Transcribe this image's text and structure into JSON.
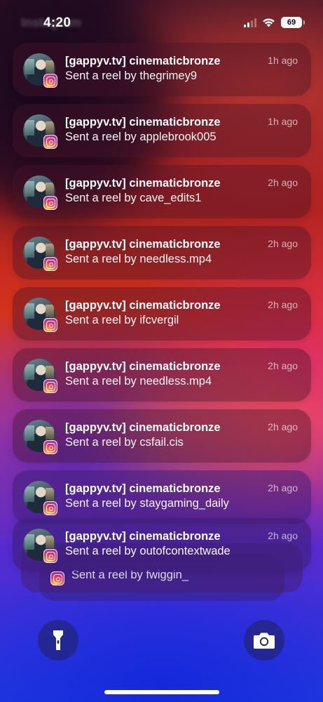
{
  "status_bar": {
    "time": "4:20",
    "faded_title": "Instagram",
    "battery": "69",
    "icons": [
      "signal-icon",
      "wifi-icon",
      "battery-icon"
    ]
  },
  "notifications": [
    {
      "app": "Instagram",
      "title": "[gappyv.tv] cinematicbronze",
      "body": "Sent a reel by thegrimey9",
      "time": "1h ago"
    },
    {
      "app": "Instagram",
      "title": "[gappyv.tv] cinematicbronze",
      "body": "Sent a reel by applebrook005",
      "time": "1h ago"
    },
    {
      "app": "Instagram",
      "title": "[gappyv.tv] cinematicbronze",
      "body": "Sent a reel by cave_edits1",
      "time": "2h ago"
    },
    {
      "app": "Instagram",
      "title": "[gappyv.tv] cinematicbronze",
      "body": "Sent a reel by needless.mp4",
      "time": "2h ago"
    },
    {
      "app": "Instagram",
      "title": "[gappyv.tv] cinematicbronze",
      "body": "Sent a reel by ifcvergil",
      "time": "2h ago"
    },
    {
      "app": "Instagram",
      "title": "[gappyv.tv] cinematicbronze",
      "body": "Sent a reel by needless.mp4",
      "time": "2h ago"
    },
    {
      "app": "Instagram",
      "title": "[gappyv.tv] cinematicbronze",
      "body": "Sent a reel by csfail.cis",
      "time": "2h ago"
    },
    {
      "app": "Instagram",
      "title": "[gappyv.tv] cinematicbronze",
      "body": "Sent a reel by staygaming_daily",
      "time": "2h ago"
    },
    {
      "app": "Instagram",
      "title": "[gappyv.tv] cinematicbronze",
      "body": "Sent a reel by outofcontextwade",
      "time": "2h ago"
    }
  ],
  "stacked_notification": {
    "body": "Sent a reel by fwiggin_"
  },
  "bottom": {
    "flashlight_icon": "flashlight-icon",
    "camera_icon": "camera-icon"
  },
  "colors": {
    "wallpaper_top": "#a61f22",
    "wallpaper_bottom": "#1f3ae0",
    "instagram_gradient": [
      "#fdd56b",
      "#e3306c",
      "#6a3fd6"
    ]
  }
}
